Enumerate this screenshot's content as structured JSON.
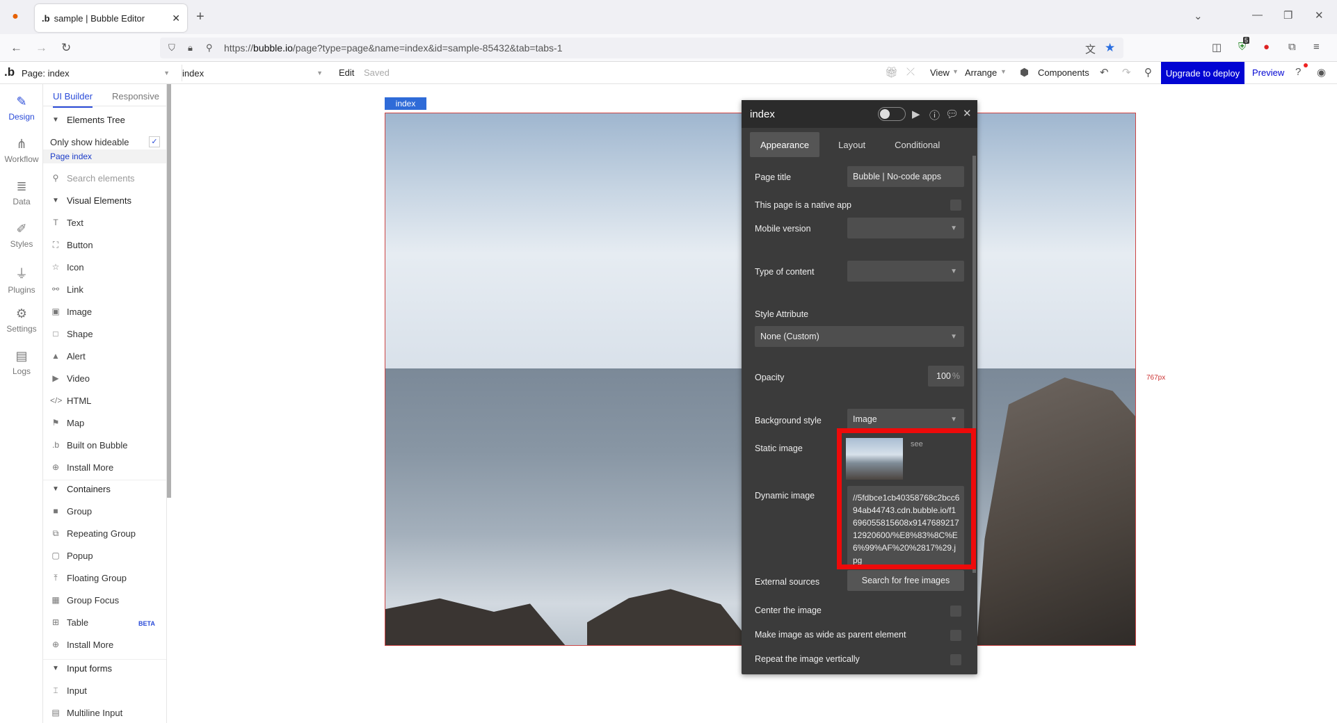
{
  "browser": {
    "tab_title": "sample | Bubble Editor",
    "url_prefix": "https://",
    "url_domain": "bubble.io",
    "url_path": "/page?type=page&name=index&id=sample-85432&tab=tabs-1",
    "extension_badge": "5"
  },
  "topbar": {
    "page_label": "Page: index",
    "page_name": "index",
    "edit": "Edit",
    "saved": "Saved",
    "view": "View",
    "arrange": "Arrange",
    "components": "Components",
    "upgrade": "Upgrade to deploy",
    "preview": "Preview"
  },
  "rail": [
    {
      "label": "Design",
      "icon": "design-icon"
    },
    {
      "label": "Workflow",
      "icon": "workflow-icon"
    },
    {
      "label": "Data",
      "icon": "data-icon"
    },
    {
      "label": "Styles",
      "icon": "styles-icon"
    },
    {
      "label": "Plugins",
      "icon": "plugins-icon"
    },
    {
      "label": "Settings",
      "icon": "settings-icon"
    },
    {
      "label": "Logs",
      "icon": "logs-icon"
    }
  ],
  "panel": {
    "tab_builder": "UI Builder",
    "tab_responsive": "Responsive",
    "elements_tree": "Elements Tree",
    "only_hideable": "Only show hideable",
    "page_index": "Page index",
    "search_placeholder": "Search elements",
    "visual_elements": "Visual Elements",
    "visual_items": [
      "Text",
      "Button",
      "Icon",
      "Link",
      "Image",
      "Shape",
      "Alert",
      "Video",
      "HTML",
      "Map",
      "Built on Bubble",
      "Install More"
    ],
    "containers": "Containers",
    "container_items": [
      "Group",
      "Repeating Group",
      "Popup",
      "Floating Group",
      "Group Focus",
      "Table",
      "Install More"
    ],
    "beta": "BETA",
    "input_forms": "Input forms",
    "input_items": [
      "Input",
      "Multiline Input"
    ]
  },
  "canvas": {
    "index_tag": "index",
    "height_label": "767px"
  },
  "property_editor": {
    "title": "index",
    "tabs": [
      "Appearance",
      "Layout",
      "Conditional"
    ],
    "page_title_label": "Page title",
    "page_title_value": "Bubble | No-code apps",
    "native_app": "This page is a native app",
    "mobile_version": "Mobile version",
    "type_of_content": "Type of content",
    "style_attribute": "Style Attribute",
    "style_value": "None (Custom)",
    "opacity": "Opacity",
    "opacity_value": "100",
    "opacity_unit": "%",
    "background_style": "Background style",
    "background_value": "Image",
    "static_image": "Static image",
    "see": "see",
    "dynamic_image": "Dynamic image",
    "dynamic_value": "//5fdbce1cb40358768c2bcc694ab44743.cdn.bubble.io/f1696055815608x914768921712920600/%E8%83%8C%E6%99%AF%20%2817%29.jpg",
    "external_sources": "External sources",
    "search_images": "Search for free images",
    "center_image": "Center the image",
    "wide_image": "Make image as wide as parent element",
    "repeat_vertical": "Repeat the image vertically"
  }
}
